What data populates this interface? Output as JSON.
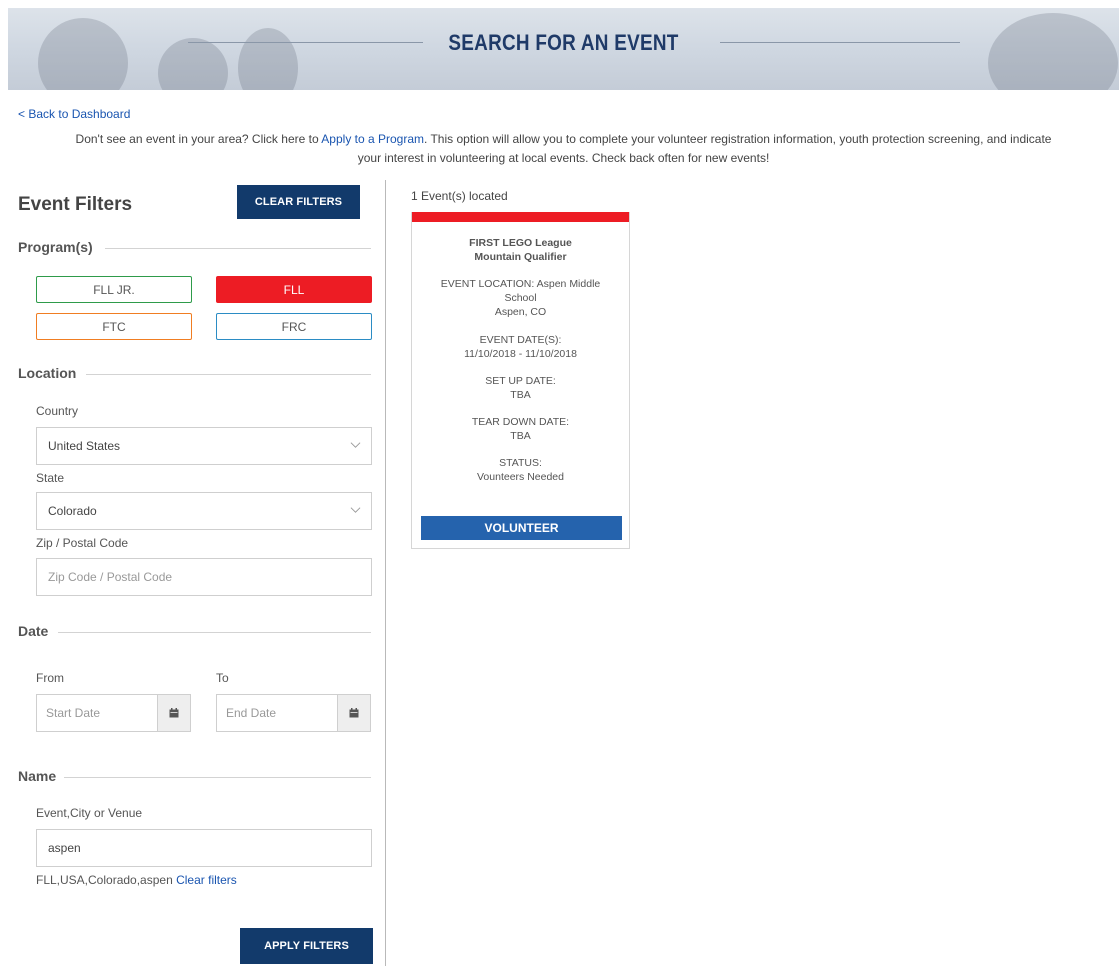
{
  "header": {
    "title": "SEARCH FOR AN EVENT"
  },
  "nav": {
    "back_link": "< Back to Dashboard"
  },
  "intro": {
    "before_link": "Don't see an event in your area? Click here to ",
    "link": "Apply to a Program",
    "after_link": ". This option will allow you to complete your volunteer registration information, youth protection screening, and indicate",
    "line2": "your interest in volunteering at local events. Check back often for new events!"
  },
  "filters": {
    "title": "Event Filters",
    "clear_label": "CLEAR FILTERS",
    "programs_label": "Program(s)",
    "programs": [
      {
        "label": "FLL JR.",
        "color": "#2e9b4a",
        "selected": false
      },
      {
        "label": "FLL",
        "color": "#ed1c24",
        "selected": true
      },
      {
        "label": "FTC",
        "color": "#f07d22",
        "selected": false
      },
      {
        "label": "FRC",
        "color": "#2b8cc4",
        "selected": false
      }
    ],
    "location_label": "Location",
    "country_label": "Country",
    "country_value": "United States",
    "state_label": "State",
    "state_value": "Colorado",
    "zip_label": "Zip / Postal Code",
    "zip_placeholder": "Zip Code / Postal Code",
    "date_label": "Date",
    "from_label": "From",
    "to_label": "To",
    "start_placeholder": "Start Date",
    "end_placeholder": "End Date",
    "name_label": "Name",
    "name_field_label": "Event,City or Venue",
    "name_value": "aspen",
    "summary_text": "FLL,USA,Colorado,aspen",
    "summary_clear": "Clear filters",
    "apply_label": "APPLY FILTERS"
  },
  "results": {
    "count_text": "1 Event(s) located",
    "events": [
      {
        "name_line1": "FIRST LEGO League",
        "name_line2": "Mountain Qualifier",
        "location_label": "EVENT LOCATION:",
        "location_value": "Aspen Middle",
        "location_line2": "School",
        "location_city": "Aspen, CO",
        "dates_label": "EVENT DATE(S):",
        "dates_value": "11/10/2018 - 11/10/2018",
        "setup_label": "SET UP DATE:",
        "setup_value": "TBA",
        "teardown_label": "TEAR DOWN DATE:",
        "teardown_value": "TBA",
        "status_label": "STATUS:",
        "status_value": "Vounteers Needed",
        "action_label": "VOLUNTEER"
      }
    ]
  },
  "colors": {
    "navy": "#123a6b",
    "accent_red": "#ed1c24",
    "volunteer_blue": "#2563ad",
    "link_blue": "#1a55b0"
  }
}
